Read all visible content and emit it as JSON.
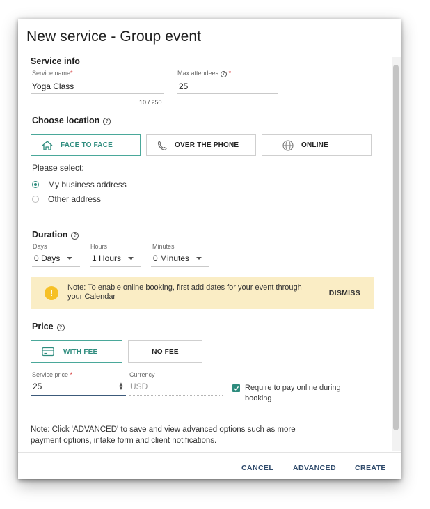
{
  "dialog": {
    "title": "New service - Group event"
  },
  "service_info": {
    "heading": "Service info",
    "name_label": "Service name",
    "name_required": "*",
    "name_value": "Yoga Class",
    "name_counter": "10 / 250",
    "attendees_label": "Max attendees",
    "attendees_required": "*",
    "attendees_value": "25"
  },
  "location": {
    "heading": "Choose location",
    "options": [
      {
        "label": "FACE TO FACE",
        "icon": "home-icon",
        "selected": true
      },
      {
        "label": "OVER THE PHONE",
        "icon": "phone-icon",
        "selected": false
      },
      {
        "label": "ONLINE",
        "icon": "globe-icon",
        "selected": false
      }
    ],
    "please_select": "Please select:",
    "address_options": [
      {
        "label": "My business address",
        "selected": true
      },
      {
        "label": "Other address",
        "selected": false
      }
    ]
  },
  "duration": {
    "heading": "Duration",
    "days_label": "Days",
    "days_value": "0 Days",
    "hours_label": "Hours",
    "hours_value": "1 Hours",
    "minutes_label": "Minutes",
    "minutes_value": "0 Minutes"
  },
  "alert": {
    "text": "Note: To enable online booking, first add dates for your event through your Calendar",
    "dismiss": "DISMISS",
    "icon": "warning-icon"
  },
  "price": {
    "heading": "Price",
    "with_fee": "WITH FEE",
    "no_fee": "NO FEE",
    "service_price_label": "Service price",
    "service_price_required": "*",
    "service_price_value": "25",
    "currency_label": "Currency",
    "currency_value": "USD",
    "require_online_line1": "Require to pay online during",
    "require_online_line2": "booking",
    "require_online_checked": true
  },
  "note": {
    "line1": "Note: Click 'ADVANCED' to save and view advanced options such as more",
    "line2": "payment options, intake form and client notifications."
  },
  "footer": {
    "cancel": "CANCEL",
    "advanced": "ADVANCED",
    "create": "CREATE"
  },
  "colors": {
    "accent": "#2e8c7e",
    "alert_bg": "#faedc5",
    "alert_icon": "#f6c026",
    "footer_text": "#2f4a6b"
  }
}
